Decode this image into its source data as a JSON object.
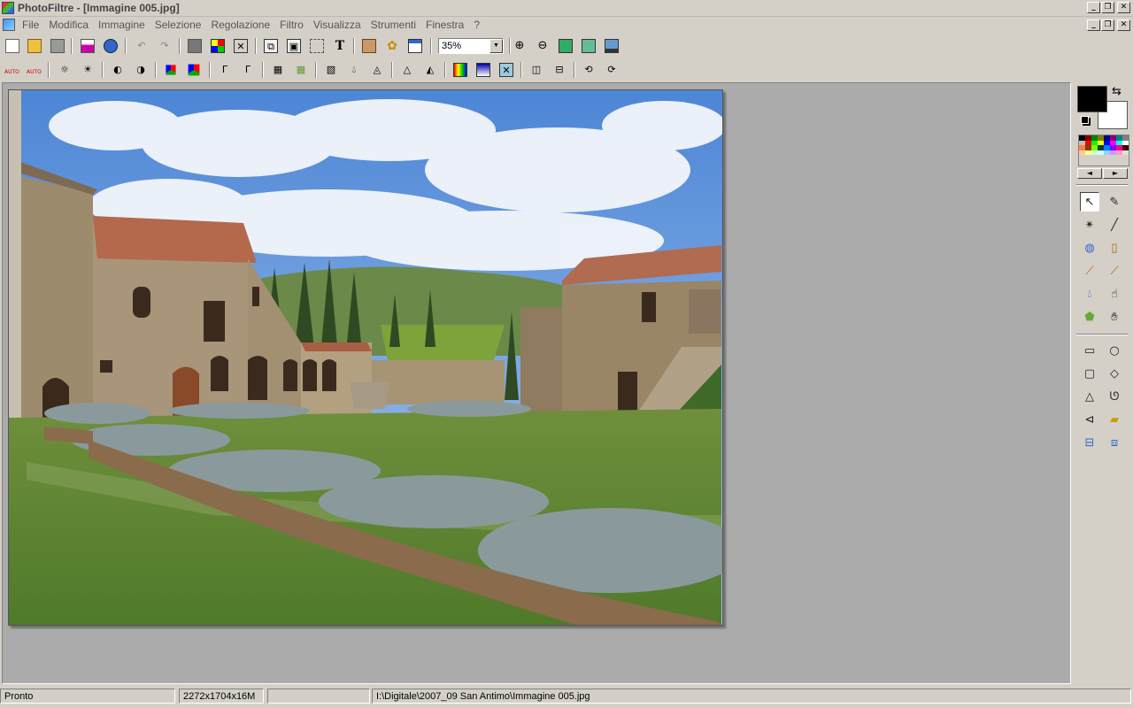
{
  "window": {
    "title": "PhotoFiltre - [Immagine 005.jpg]",
    "controls": [
      "_",
      "❐",
      "✕"
    ]
  },
  "menu": {
    "items": [
      "File",
      "Modifica",
      "Immagine",
      "Selezione",
      "Regolazione",
      "Filtro",
      "Visualizza",
      "Strumenti",
      "Finestra",
      "?"
    ]
  },
  "toolbar1": {
    "zoom_value": "35%",
    "icons": [
      "new-icon",
      "open-icon",
      "save-icon",
      "print-icon",
      "scan-icon",
      "undo-icon",
      "redo-icon",
      "color-mode-icon",
      "palette-icon",
      "transparency-icon",
      "select-copy-icon",
      "paste-icon",
      "crop-select-icon",
      "text-icon",
      "automation-icon",
      "plugins-icon",
      "preview-icon",
      "zoom-in-icon",
      "zoom-out-icon",
      "fit-window-icon",
      "actual-size-icon",
      "fullscreen-icon"
    ]
  },
  "toolbar2": {
    "auto_label": "AUTO"
  },
  "colors": {
    "foreground": "#000000",
    "background": "#ffffff",
    "palette": [
      "#000000",
      "#800000",
      "#008000",
      "#808000",
      "#000080",
      "#800080",
      "#008080",
      "#808080",
      "#c0c0c0",
      "#ff0000",
      "#00ff00",
      "#ffff00",
      "#0000ff",
      "#ff00ff",
      "#00ffff",
      "#ffffff",
      "#ff8040",
      "#804000",
      "#80ff00",
      "#004040",
      "#0080ff",
      "#8000ff",
      "#ff0080",
      "#400000",
      "#ffcc99",
      "#ffff99",
      "#ccffcc",
      "#ccffff",
      "#99ccff",
      "#cc99ff",
      "#ff99cc",
      "#e0e0e0"
    ]
  },
  "statusbar": {
    "state": "Pronto",
    "dimensions": "2272x1704x16M",
    "extra": "",
    "path": "I:\\Digitale\\2007_09 San Antimo\\Immagine 005.jpg"
  }
}
